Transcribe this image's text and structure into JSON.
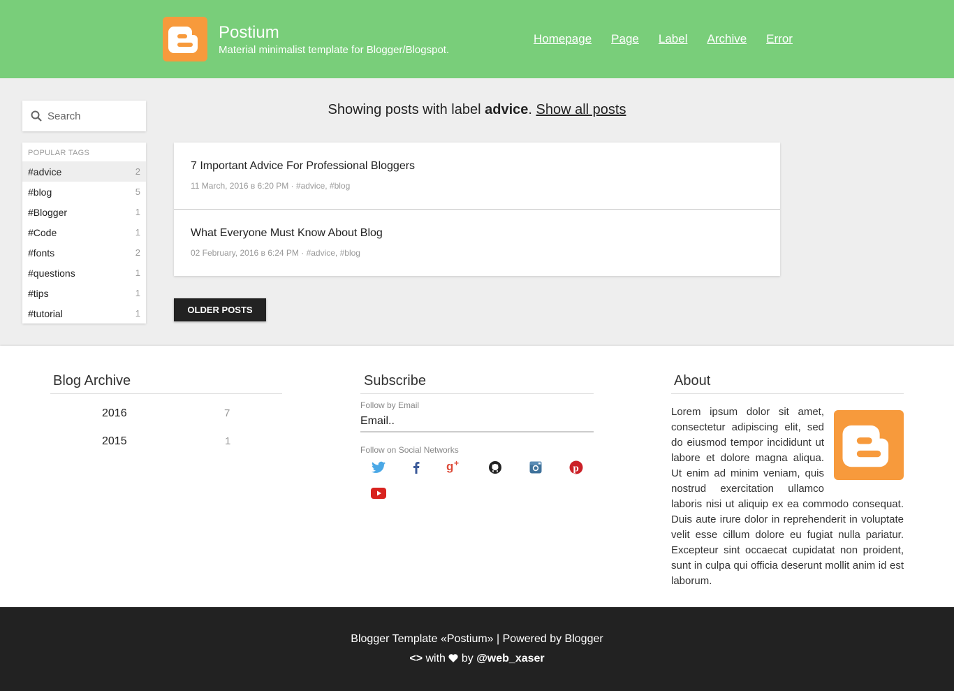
{
  "header": {
    "site_title": "Postium",
    "site_description": "Material minimalist template for Blogger/Blogspot.",
    "logo_icon": "blogger-icon",
    "bg_color": "#79ce7a",
    "logo_color": "#f79a3c",
    "nav": [
      {
        "label": "Homepage"
      },
      {
        "label": "Page"
      },
      {
        "label": "Label"
      },
      {
        "label": "Archive"
      },
      {
        "label": "Error"
      }
    ]
  },
  "sidebar": {
    "search_placeholder": "Search",
    "tags_title": "POPULAR TAGS",
    "tags": [
      {
        "name": "#advice",
        "count": "2"
      },
      {
        "name": "#blog",
        "count": "5"
      },
      {
        "name": "#Blogger",
        "count": "1"
      },
      {
        "name": "#Code",
        "count": "1"
      },
      {
        "name": "#fonts",
        "count": "2"
      },
      {
        "name": "#questions",
        "count": "1"
      },
      {
        "name": "#tips",
        "count": "1"
      },
      {
        "name": "#tutorial",
        "count": "1"
      }
    ]
  },
  "main": {
    "heading_prefix": "Showing posts with label ",
    "heading_label": "advice",
    "heading_sep": ". ",
    "show_all": "Show all posts",
    "posts": [
      {
        "title": "7 Important Advice For Professional Bloggers",
        "meta": "11 March, 2016 в 6:20 PM · #advice, #blog"
      },
      {
        "title": "What Everyone Must Know About Blog",
        "meta": "02 February, 2016 в 6:24 PM · #advice, #blog"
      }
    ],
    "older_posts": "OLDER POSTS"
  },
  "footer_widgets": {
    "archive": {
      "title": "Blog Archive",
      "years": [
        {
          "year": "2016",
          "count": "7"
        },
        {
          "year": "2015",
          "count": "1"
        }
      ]
    },
    "subscribe": {
      "title": "Subscribe",
      "email_label": "Follow by Email",
      "email_placeholder": "Email..",
      "social_label": "Follow on Social Networks",
      "networks": [
        "twitter-icon",
        "facebook-icon",
        "google-plus-icon",
        "github-icon",
        "instagram-icon",
        "pinterest-icon",
        "youtube-icon"
      ]
    },
    "about": {
      "title": "About",
      "text": "Lorem ipsum dolor sit amet, consectetur adipiscing elit, sed do eiusmod tempor incididunt ut labore et dolore magna aliqua. Ut enim ad minim veniam, quis nostrud exercitation ullamco laboris nisi ut aliquip ex ea commodo consequat. Duis aute irure dolor in reprehenderit in voluptate velit esse cillum dolore eu fugiat nulla pariatur. Excepteur sint occaecat cupidatat non proident, sunt in culpa qui officia deserunt mollit anim id est laborum."
    }
  },
  "bottom": {
    "line1": "Blogger Template «Postium» | Powered by Blogger",
    "code_glyph": "<>",
    "with": "with",
    "by": "by",
    "author": "@web_xaser"
  }
}
